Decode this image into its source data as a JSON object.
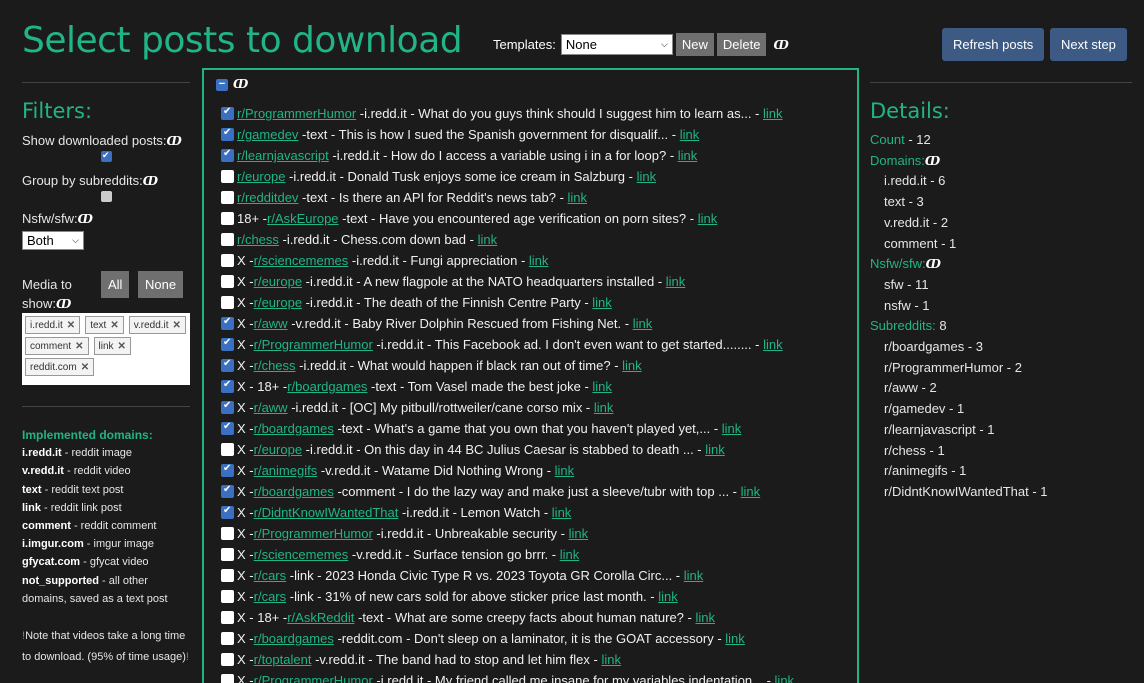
{
  "header": {
    "title": "Select posts to download",
    "templates_label": "Templates:",
    "templates_value": "None",
    "new_label": "New",
    "delete_label": "Delete",
    "info_glyph": "ↀ",
    "refresh_label": "Refresh posts",
    "next_label": "Next step"
  },
  "filters": {
    "heading": "Filters:",
    "show_downloaded_label": "Show downloaded posts:",
    "show_downloaded_checked": true,
    "group_by_label": "Group by subreddits:",
    "group_by_checked": false,
    "nsfw_label": "Nsfw/sfw:",
    "nsfw_value": "Both",
    "media_label_1": "Media to",
    "media_label_2": "show:",
    "all_label": "All",
    "none_label": "None",
    "tags": [
      "i.redd.it",
      "text",
      "v.redd.it",
      "comment",
      "link",
      "reddit.com"
    ]
  },
  "implemented": {
    "heading": "Implemented domains:",
    "items": [
      {
        "key": "i.redd.it",
        "desc": " - reddit image"
      },
      {
        "key": "v.redd.it",
        "desc": " - reddit video"
      },
      {
        "key": "text",
        "desc": " - reddit text post"
      },
      {
        "key": "link",
        "desc": " - reddit link post"
      },
      {
        "key": "comment",
        "desc": " - reddit comment"
      },
      {
        "key": "i.imgur.com",
        "desc": " - imgur image"
      },
      {
        "key": "gfycat.com",
        "desc": " - gfycat video"
      },
      {
        "key": "not_supported",
        "desc": " - all other"
      }
    ],
    "extra": "domains, saved as a text post",
    "note_excl": "!",
    "note_1": "Note that videos take a long time",
    "note_2": "to download. (95% of time usage)"
  },
  "posts": [
    {
      "checked": true,
      "prefix": "",
      "sub": "r/ProgrammerHumor",
      "text": " -i.redd.it - What do you guys think should I suggest him to learn as... - ",
      "link": "link"
    },
    {
      "checked": true,
      "prefix": "",
      "sub": "r/gamedev",
      "text": " -text - This is how I sued the Spanish government for disqualif... - ",
      "link": "link"
    },
    {
      "checked": true,
      "prefix": "",
      "sub": "r/learnjavascript",
      "text": " -i.redd.it - How do I access a variable using i in a for loop? - ",
      "link": "link"
    },
    {
      "checked": false,
      "prefix": "",
      "sub": "r/europe",
      "text": " -i.redd.it - Donald Tusk enjoys some ice cream in Salzburg - ",
      "link": "link"
    },
    {
      "checked": false,
      "prefix": "",
      "sub": "r/redditdev",
      "text": " -text - Is there an API for Reddit's news tab? - ",
      "link": "link"
    },
    {
      "checked": false,
      "prefix": "18+ - ",
      "sub": "r/AskEurope",
      "text": " -text - Have you encountered age verification on porn sites? - ",
      "link": "link"
    },
    {
      "checked": false,
      "prefix": "",
      "sub": "r/chess",
      "text": " -i.redd.it - Chess.com down bad - ",
      "link": "link"
    },
    {
      "checked": false,
      "prefix": "X - ",
      "sub": "r/sciencememes",
      "text": " -i.redd.it - Fungi appreciation - ",
      "link": "link"
    },
    {
      "checked": false,
      "prefix": "X - ",
      "sub": "r/europe",
      "text": " -i.redd.it - A new flagpole at the NATO headquarters installed - ",
      "link": "link"
    },
    {
      "checked": false,
      "prefix": "X - ",
      "sub": "r/europe",
      "text": " -i.redd.it - The death of the Finnish Centre Party - ",
      "link": "link"
    },
    {
      "checked": true,
      "prefix": "X - ",
      "sub": "r/aww",
      "text": " -v.redd.it - Baby River Dolphin Rescued from Fishing Net. - ",
      "link": "link"
    },
    {
      "checked": true,
      "prefix": "X - ",
      "sub": "r/ProgrammerHumor",
      "text": " -i.redd.it - This Facebook ad. I don't even want to get started........ - ",
      "link": "link"
    },
    {
      "checked": true,
      "prefix": "X - ",
      "sub": "r/chess",
      "text": " -i.redd.it - What would happen if black ran out of time? - ",
      "link": "link"
    },
    {
      "checked": true,
      "prefix": "X - 18+ - ",
      "sub": "r/boardgames",
      "text": " -text - Tom Vasel made the best joke - ",
      "link": "link"
    },
    {
      "checked": true,
      "prefix": "X - ",
      "sub": "r/aww",
      "text": " -i.redd.it - [OC] My pitbull/rottweiler/cane corso mix - ",
      "link": "link"
    },
    {
      "checked": true,
      "prefix": "X - ",
      "sub": "r/boardgames",
      "text": " -text - What's a game that you own that you haven't played yet,... - ",
      "link": "link"
    },
    {
      "checked": false,
      "prefix": "X - ",
      "sub": "r/europe",
      "text": " -i.redd.it - On this day in 44 BC Julius Caesar is stabbed to death ... - ",
      "link": "link"
    },
    {
      "checked": true,
      "prefix": "X - ",
      "sub": "r/animegifs",
      "text": " -v.redd.it - Watame Did Nothing Wrong - ",
      "link": "link"
    },
    {
      "checked": true,
      "prefix": "X - ",
      "sub": "r/boardgames",
      "text": " -comment - I do the lazy way and make just a sleeve/tubr with top ... - ",
      "link": "link"
    },
    {
      "checked": true,
      "prefix": "X - ",
      "sub": "r/DidntKnowIWantedThat",
      "text": " -i.redd.it - Lemon Watch - ",
      "link": "link"
    },
    {
      "checked": false,
      "prefix": "X - ",
      "sub": "r/ProgrammerHumor",
      "text": " -i.redd.it - Unbreakable security - ",
      "link": "link"
    },
    {
      "checked": false,
      "prefix": "X - ",
      "sub": "r/sciencememes",
      "text": " -v.redd.it - Surface tension go brrr. - ",
      "link": "link"
    },
    {
      "checked": false,
      "prefix": "X - ",
      "sub": "r/cars",
      "text": " -link - 2023 Honda Civic Type R vs. 2023 Toyota GR Corolla Circ... - ",
      "link": "link"
    },
    {
      "checked": false,
      "prefix": "X - ",
      "sub": "r/cars",
      "text": " -link - 31% of new cars sold for above sticker price last month. - ",
      "link": "link"
    },
    {
      "checked": false,
      "prefix": "X - 18+ - ",
      "sub": "r/AskReddit",
      "text": " -text - What are some creepy facts about human nature? - ",
      "link": "link"
    },
    {
      "checked": false,
      "prefix": "X - ",
      "sub": "r/boardgames",
      "text": " -reddit.com - Don't sleep on a laminator, it is the GOAT accessory - ",
      "link": "link"
    },
    {
      "checked": false,
      "prefix": "X - ",
      "sub": "r/toptalent",
      "text": " -v.redd.it - The band had to stop and let him flex - ",
      "link": "link"
    },
    {
      "checked": false,
      "prefix": "X - ",
      "sub": "r/ProgrammerHumor",
      "text": " -i.redd.it - My friend called me insane for my variables indentation... - ",
      "link": "link"
    }
  ],
  "details": {
    "heading": "Details:",
    "count_label": "Count",
    "count_value": " - 12",
    "domains_label": "Domains:",
    "domains": [
      "i.redd.it - 6",
      "text - 3",
      "v.redd.it - 2",
      "comment - 1"
    ],
    "nsfw_label": "Nsfw/sfw:",
    "nsfw": [
      "sfw - 11",
      "nsfw - 1"
    ],
    "subreddits_label": "Subreddits:",
    "subreddits_count": " 8",
    "subreddits": [
      "r/boardgames - 3",
      "r/ProgrammerHumor - 2",
      "r/aww - 2",
      "r/gamedev - 1",
      "r/learnjavascript - 1",
      "r/chess - 1",
      "r/animegifs - 1",
      "r/DidntKnowIWantedThat - 1"
    ]
  },
  "colors": {
    "accent": "#20b487",
    "button_blue": "#3c5a84",
    "checkbox_blue": "#3a6fc2",
    "background": "#1b1b1b"
  }
}
